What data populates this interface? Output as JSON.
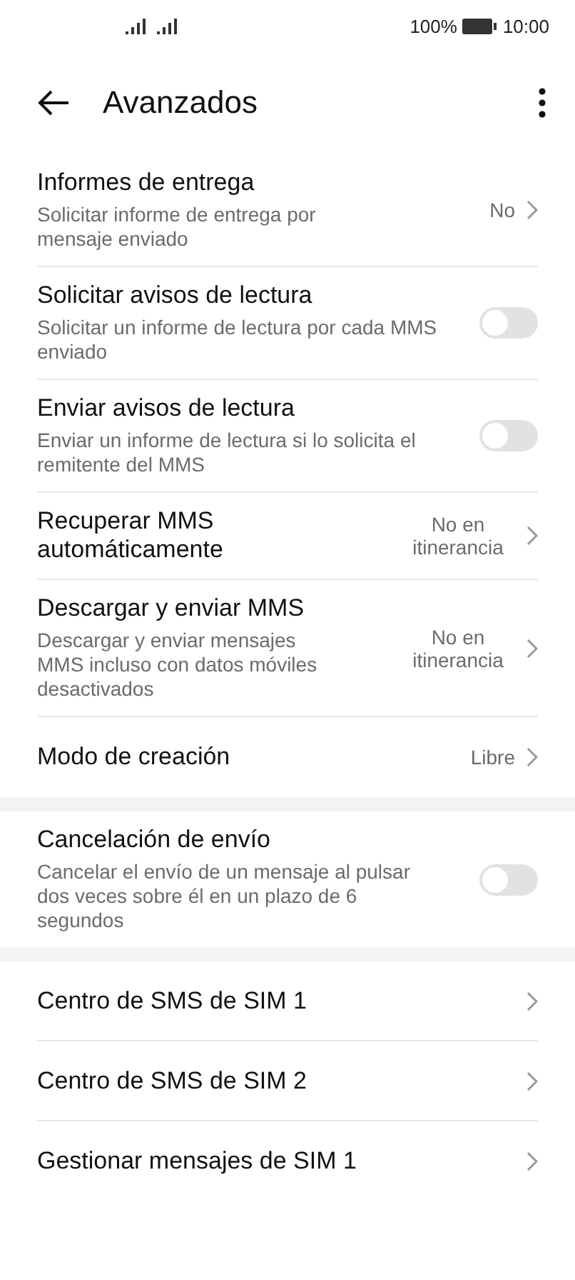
{
  "status_bar": {
    "battery": "100%",
    "time": "10:00"
  },
  "header": {
    "title": "Avanzados"
  },
  "groups": [
    {
      "items": [
        {
          "kind": "nav",
          "title": "Informes de entrega",
          "subtitle": "Solicitar informe de entrega por mensaje enviado",
          "value": "No"
        },
        {
          "kind": "toggle",
          "title": "Solicitar avisos de lectura",
          "subtitle": "Solicitar un informe de lectura por cada MMS enviado",
          "on": false
        },
        {
          "kind": "toggle",
          "title": "Enviar avisos de lectura",
          "subtitle": "Enviar un informe de lectura si lo solicita el remitente del MMS",
          "on": false
        },
        {
          "kind": "nav",
          "title": "Recuperar MMS automáticamente",
          "value": "No en itinerancia"
        },
        {
          "kind": "nav",
          "title": "Descargar y enviar MMS",
          "subtitle": "Descargar y enviar mensajes MMS incluso con datos móviles desactivados",
          "value": "No en itinerancia"
        },
        {
          "kind": "nav",
          "title": "Modo de creación",
          "value": "Libre"
        }
      ]
    },
    {
      "items": [
        {
          "kind": "toggle",
          "title": "Cancelación de envío",
          "subtitle": "Cancelar el envío de un mensaje al pulsar dos veces sobre él en un plazo de 6 segundos",
          "on": false
        }
      ]
    },
    {
      "items": [
        {
          "kind": "nav",
          "title": "Centro de SMS de SIM 1"
        },
        {
          "kind": "nav",
          "title": "Centro de SMS de SIM 2"
        },
        {
          "kind": "nav",
          "title": "Gestionar mensajes de SIM 1"
        }
      ]
    }
  ]
}
